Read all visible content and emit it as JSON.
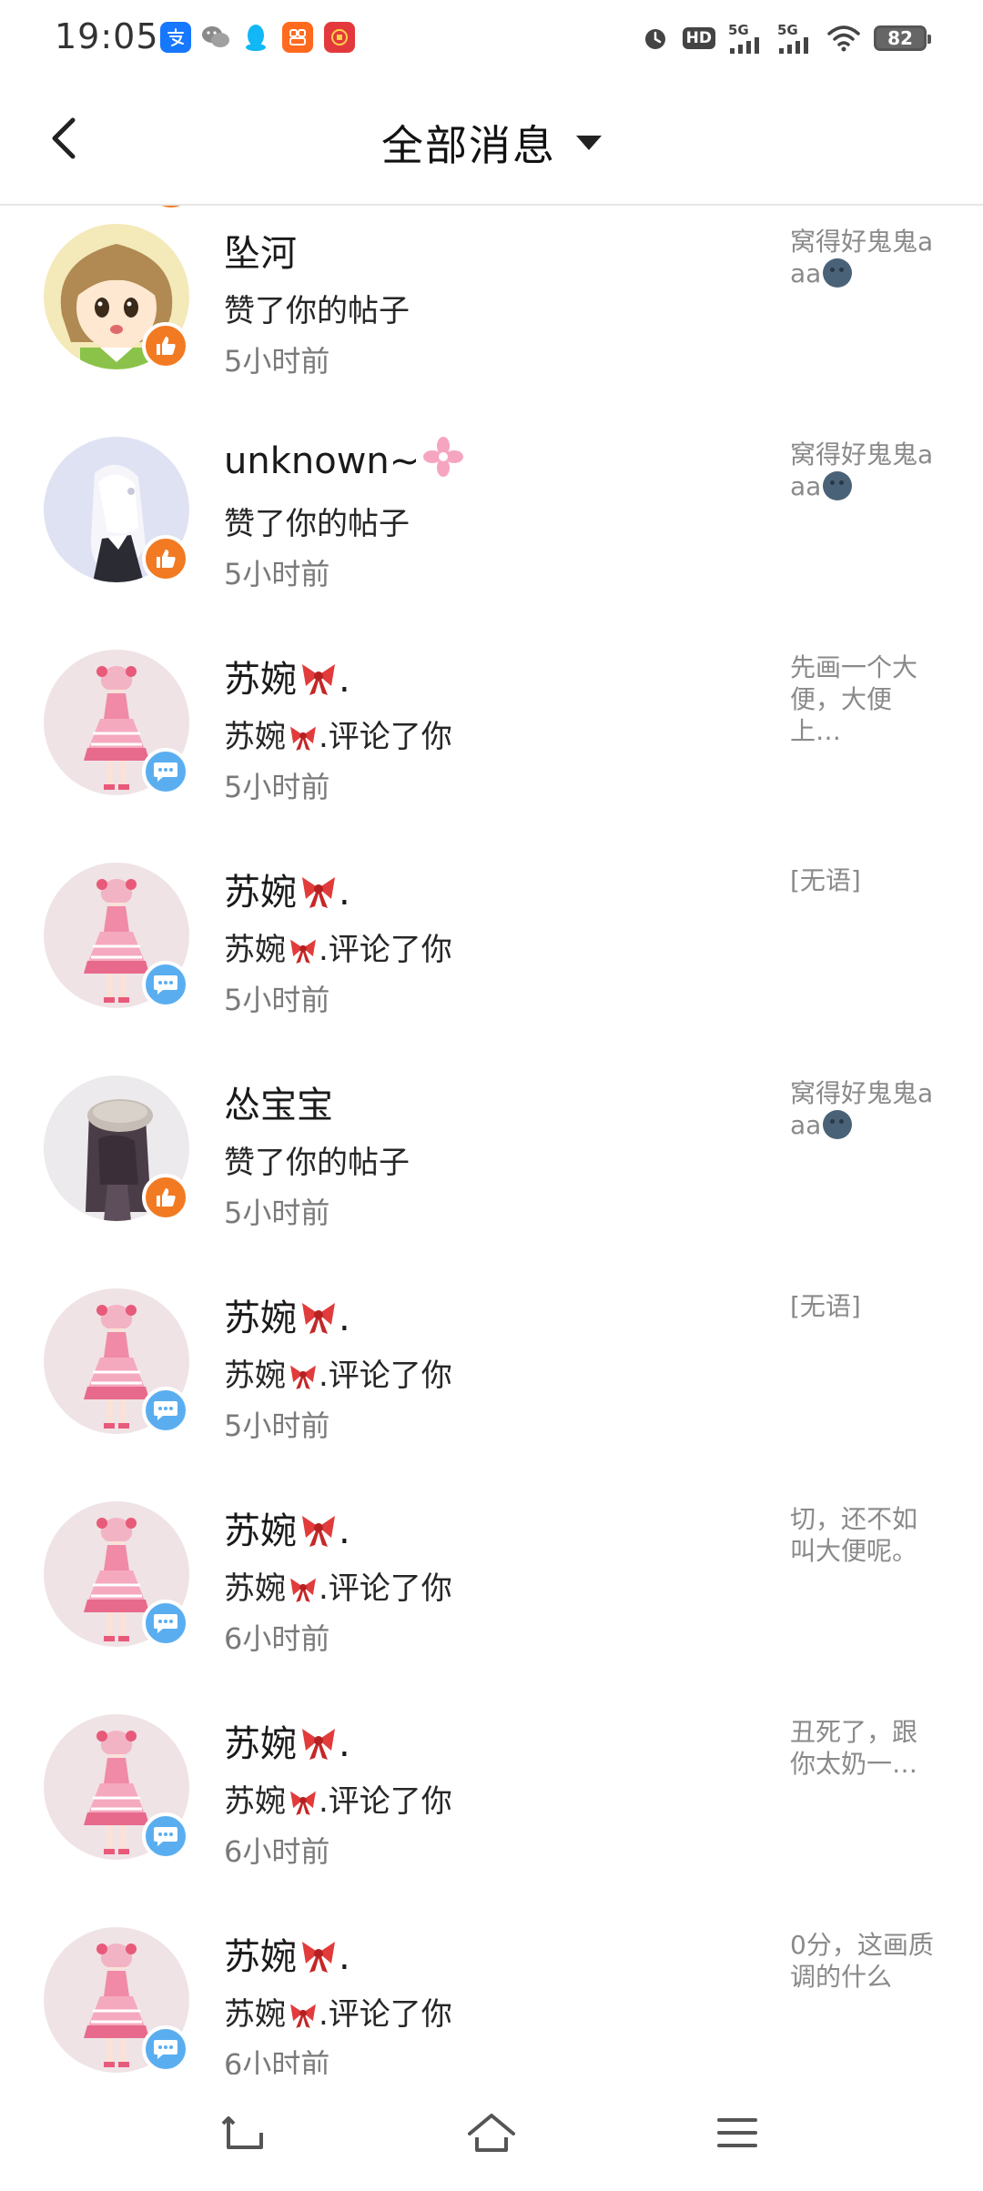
{
  "status_bar": {
    "time": "19:05",
    "battery": "82",
    "network_1": "5G",
    "network_2": "5G",
    "hd_label": "HD",
    "apps": [
      "alipay-icon",
      "wechat-icon",
      "qq-icon",
      "taobao-icon",
      "app-icon"
    ]
  },
  "header": {
    "title": "全部消息",
    "back_icon": "chevron-left-icon",
    "dropdown_icon": "caret-down-icon"
  },
  "colors": {
    "like_badge": "#f27a22",
    "comment_badge": "#5aaef0",
    "preview_text": "#8a8a8a",
    "time_text": "#7a7a7a"
  },
  "messages": [
    {
      "name": "坠河",
      "action": "赞了你的帖子",
      "time": "5小时前",
      "preview": "窝得好鬼鬼aaa",
      "type": "like",
      "avatar": "anime-girl-brown-hair"
    },
    {
      "name": "unknown~",
      "action": "赞了你的帖子",
      "time": "5小时前",
      "preview": "窝得好鬼鬼aaa",
      "type": "like",
      "avatar": "anime-girl-white-hair"
    },
    {
      "name": "苏婉",
      "name_suffix": ".",
      "action_name": "苏婉",
      "action": ".评论了你",
      "time": "5小时前",
      "preview": "先画一个大便，大便上…",
      "type": "comment",
      "avatar": "pink-dress-girl"
    },
    {
      "name": "苏婉",
      "name_suffix": ".",
      "action_name": "苏婉",
      "action": ".评论了你",
      "time": "5小时前",
      "preview": "[无语]",
      "type": "comment",
      "avatar": "pink-dress-girl"
    },
    {
      "name": "怂宝宝",
      "action": "赞了你的帖子",
      "time": "5小时前",
      "preview": "窝得好鬼鬼aaa",
      "type": "like",
      "avatar": "anime-girl-dark-hair"
    },
    {
      "name": "苏婉",
      "name_suffix": ".",
      "action_name": "苏婉",
      "action": ".评论了你",
      "time": "5小时前",
      "preview": "[无语]",
      "type": "comment",
      "avatar": "pink-dress-girl"
    },
    {
      "name": "苏婉",
      "name_suffix": ".",
      "action_name": "苏婉",
      "action": ".评论了你",
      "time": "6小时前",
      "preview": "切，还不如叫大便呢。",
      "type": "comment",
      "avatar": "pink-dress-girl"
    },
    {
      "name": "苏婉",
      "name_suffix": ".",
      "action_name": "苏婉",
      "action": ".评论了你",
      "time": "6小时前",
      "preview": "丑死了，跟你太奶一…",
      "type": "comment",
      "avatar": "pink-dress-girl"
    },
    {
      "name": "苏婉",
      "name_suffix": ".",
      "action_name": "苏婉",
      "action": ".评论了你",
      "time": "6小时前",
      "preview": "0分，这画质调的什么",
      "type": "comment",
      "avatar": "pink-dress-girl"
    }
  ],
  "bottom_nav": {
    "back_icon": "return-icon",
    "home_icon": "home-icon",
    "menu_icon": "menu-icon"
  }
}
